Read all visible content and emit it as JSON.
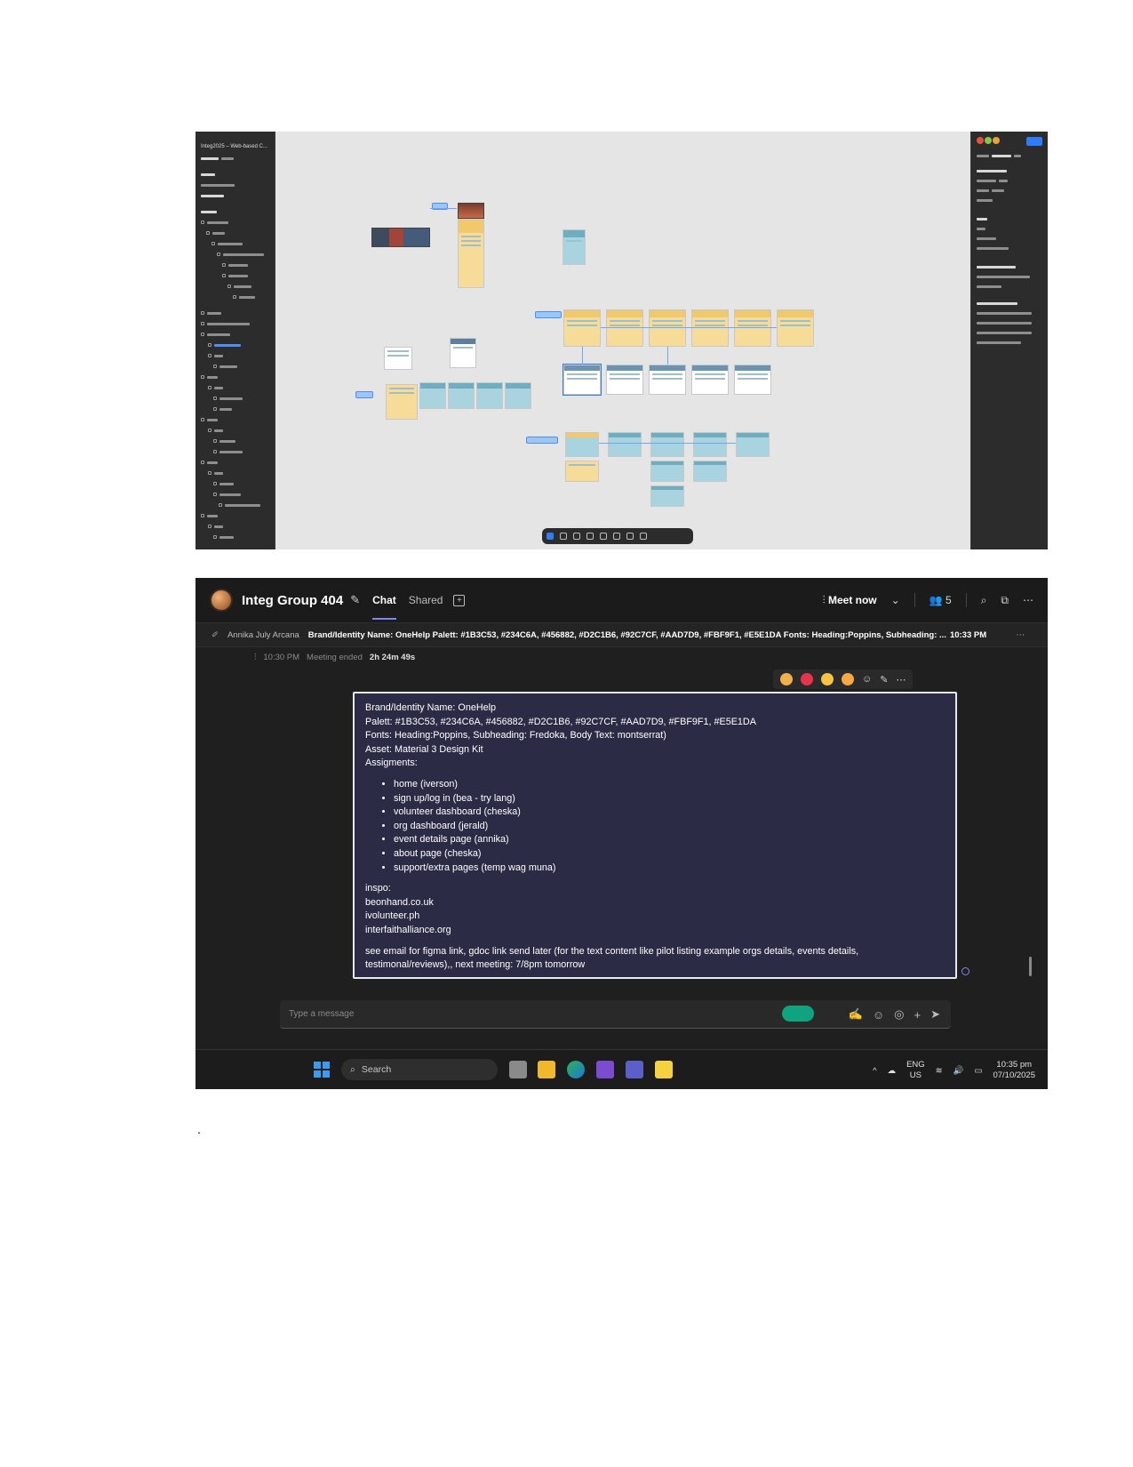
{
  "figma": {
    "file_title": "Integ2025 – Web-based C..."
  },
  "teams": {
    "header": {
      "title": "Integ Group 404",
      "tabs": [
        "Chat",
        "Shared"
      ],
      "meet_now": "Meet now",
      "participants_count": "5"
    },
    "pinned": {
      "author": "Annika July Arcana",
      "text": "Brand/Identity Name: OneHelp Palett: #1B3C53, #234C6A, #456882, #D2C1B6, #92C7CF, #AAD7D9, #FBF9F1, #E5E1DA Fonts: Heading:Poppins, Subheading: ...",
      "time": "10:33 PM"
    },
    "meeting": {
      "time": "10:30 PM",
      "label": "Meeting ended",
      "duration": "2h 24m 49s"
    },
    "message": {
      "line1": "Brand/Identity Name: OneHelp",
      "line2": "Palett: #1B3C53, #234C6A, #456882, #D2C1B6, #92C7CF, #AAD7D9, #FBF9F1, #E5E1DA",
      "line3": "Fonts: Heading:Poppins, Subheading: Fredoka, Body Text: montserrat)",
      "line4": "Asset: Material 3 Design Kit",
      "line5": "Assigments:",
      "assignments": [
        "home (iverson)",
        "sign up/log in (bea - try lang)",
        "volunteer dashboard (cheska)",
        "org dashboard (jerald)",
        "event details page (annika)",
        "about page (cheska)",
        "support/extra pages (temp wag muna)"
      ],
      "inspo_label": "inspo:",
      "inspo_links": [
        "beonhand.co.uk",
        "ivolunteer.ph",
        "interfaithalliance.org"
      ],
      "footer": "see email for figma link, gdoc link send later (for the text content like pilot listing example orgs details, events details, testimonal/reviews),, next meeting: 7/8pm tomorrow"
    },
    "composer": {
      "placeholder": "Type a message"
    },
    "taskbar": {
      "search": "Search",
      "lang1": "ENG",
      "lang2": "US",
      "time": "10:35 pm",
      "date": "07/10/2025"
    }
  },
  "footnote": "."
}
